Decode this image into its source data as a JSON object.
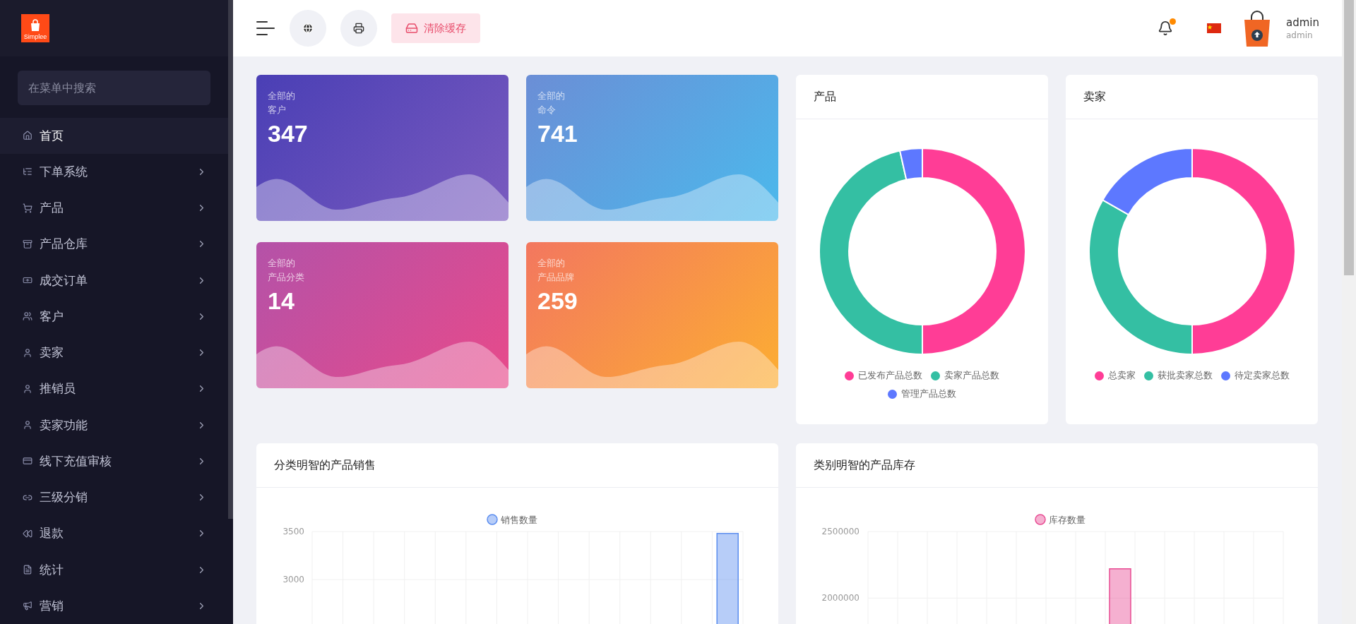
{
  "sidebar": {
    "logo": "Simplee",
    "search": {
      "placeholder": "在菜单中搜索"
    },
    "items": [
      {
        "label": "首页",
        "selected": true,
        "expandable": false
      },
      {
        "label": "下单系统",
        "selected": false,
        "expandable": true
      },
      {
        "label": "产品",
        "selected": false,
        "expandable": true
      },
      {
        "label": "产品仓库",
        "selected": false,
        "expandable": true
      },
      {
        "label": "成交订单",
        "selected": false,
        "expandable": true
      },
      {
        "label": "客户",
        "selected": false,
        "expandable": true
      },
      {
        "label": "卖家",
        "selected": false,
        "expandable": true
      },
      {
        "label": "推销员",
        "selected": false,
        "expandable": true
      },
      {
        "label": "卖家功能",
        "selected": false,
        "expandable": true
      },
      {
        "label": "线下充值审核",
        "selected": false,
        "expandable": true
      },
      {
        "label": "三级分销",
        "selected": false,
        "expandable": true
      },
      {
        "label": "退款",
        "selected": false,
        "expandable": true
      },
      {
        "label": "统计",
        "selected": false,
        "expandable": true
      },
      {
        "label": "营销",
        "selected": false,
        "expandable": true
      }
    ]
  },
  "header": {
    "clear_cache": "清除缓存",
    "notification_unread": true,
    "user": {
      "name": "admin",
      "role": "admin"
    }
  },
  "stats": [
    {
      "caption": "全部的",
      "label": "客户",
      "value": "347",
      "kind": "purple"
    },
    {
      "caption": "全部的",
      "label": "命令",
      "value": "741",
      "kind": "blue"
    },
    {
      "caption": "全部的",
      "label": "产品分类",
      "value": "14",
      "kind": "pink"
    },
    {
      "caption": "全部的",
      "label": "产品品牌",
      "value": "259",
      "kind": "orange"
    }
  ],
  "donuts": [
    {
      "title": "产品",
      "legend": [
        {
          "label": "已发布产品总数",
          "color": "#ff3d96"
        },
        {
          "label": "卖家产品总数",
          "color": "#34bfa3"
        },
        {
          "label": "管理产品总数",
          "color": "#5d78ff"
        }
      ]
    },
    {
      "title": "卖家",
      "legend": [
        {
          "label": "总卖家",
          "color": "#ff3d96"
        },
        {
          "label": "获批卖家总数",
          "color": "#34bfa3"
        },
        {
          "label": "待定卖家总数",
          "color": "#5d78ff"
        }
      ]
    }
  ],
  "bar_charts": [
    {
      "title": "分类明智的产品销售",
      "chart_data": {
        "type": "bar",
        "ylim": [
          2530,
          3500
        ],
        "yticks": [
          3000,
          3500
        ],
        "series": [
          {
            "name": "销售数量",
            "color": "#5b8def",
            "values": [
              null,
              null,
              null,
              null,
              null,
              null,
              null,
              null,
              null,
              null,
              null,
              null,
              null,
              3480
            ]
          }
        ]
      }
    },
    {
      "title": "类别明智的产品库存",
      "chart_data": {
        "type": "bar",
        "ylim": [
          1800000,
          2500000
        ],
        "yticks": [
          2000000,
          2500000
        ],
        "series": [
          {
            "name": "库存数量",
            "color": "#e84c93",
            "values": [
              null,
              null,
              null,
              null,
              null,
              null,
              null,
              null,
              2220000,
              null,
              null,
              null,
              null,
              null
            ]
          }
        ]
      }
    }
  ]
}
